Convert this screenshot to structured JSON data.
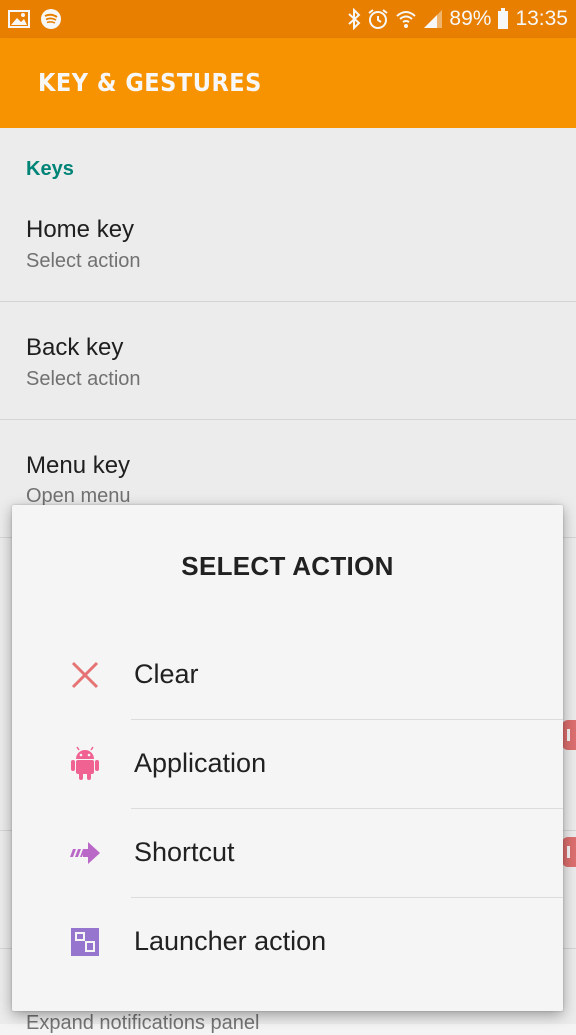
{
  "status_bar": {
    "battery": "89%",
    "time": "13:35",
    "icons": [
      "image-icon",
      "spotify-icon",
      "bluetooth-icon",
      "alarm-icon",
      "wifi-icon",
      "signal-icon",
      "battery-icon"
    ]
  },
  "appbar": {
    "title": "KEY & GESTURES"
  },
  "section": {
    "header": "Keys"
  },
  "prefs": [
    {
      "title": "Home key",
      "summary": "Select action"
    },
    {
      "title": "Back key",
      "summary": "Select action"
    },
    {
      "title": "Menu key",
      "summary": "Open menu"
    }
  ],
  "bottom_summary": "Expand notifications panel",
  "dialog": {
    "title": "SELECT ACTION",
    "options": [
      {
        "label": "Clear",
        "icon": "clear-icon",
        "color": "#e57373"
      },
      {
        "label": "Application",
        "icon": "android-icon",
        "color": "#f06292"
      },
      {
        "label": "Shortcut",
        "icon": "shortcut-arrow-icon",
        "color": "#ba68c8"
      },
      {
        "label": "Launcher action",
        "icon": "launcher-icon",
        "color": "#9575cd"
      }
    ]
  },
  "colors": {
    "status_bar": "#f08400",
    "app_bar": "#ff9800",
    "accent": "#00897b",
    "badge": "#e57373"
  }
}
